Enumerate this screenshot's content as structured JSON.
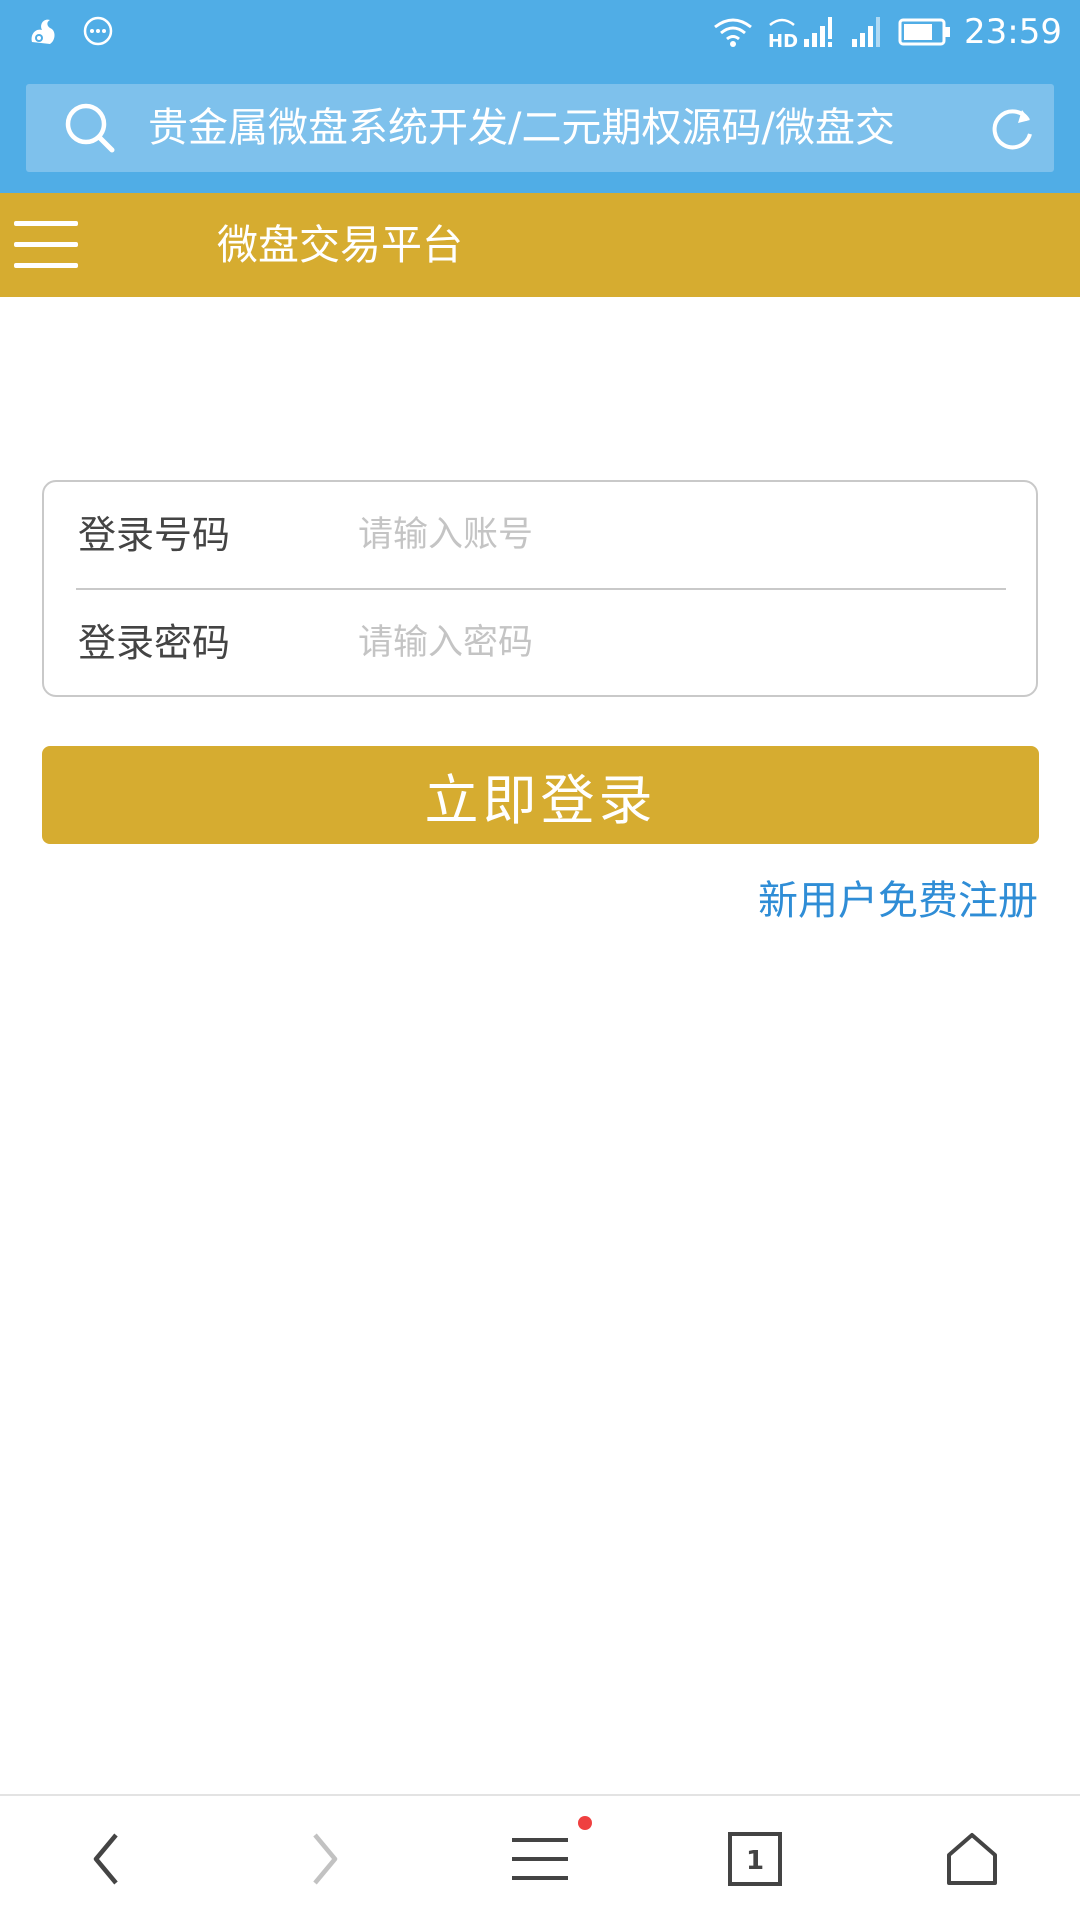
{
  "status_bar": {
    "time": "23:59",
    "network_label": "HD"
  },
  "browser": {
    "address_text": "贵金属微盘系统开发/二元期权源码/微盘交"
  },
  "header": {
    "title": "微盘交易平台"
  },
  "login_form": {
    "account_label": "登录号码",
    "account_placeholder": "请输入账号",
    "password_label": "登录密码",
    "password_placeholder": "请输入密码",
    "submit_label": "立即登录",
    "register_link": "新用户免费注册"
  },
  "bottom_bar": {
    "tab_count": "1"
  },
  "colors": {
    "status_blue": "#50ade6",
    "address_box": "#7ec1ec",
    "gold": "#d6ac30",
    "link_blue": "#2f8dd6",
    "notify_red": "#ef4040"
  },
  "icons": {
    "status_left": [
      "uc-squirrel-icon",
      "message-bubble-icon"
    ],
    "status_right": [
      "wifi-icon",
      "hd-signal-icon",
      "cell-signal-icon",
      "cell-signal-2-icon",
      "battery-icon"
    ],
    "address": [
      "search-icon",
      "refresh-icon"
    ],
    "header": [
      "hamburger-menu-icon"
    ],
    "bottom_bar": [
      "back-arrow-icon",
      "forward-arrow-icon",
      "menu-icon",
      "tabs-icon",
      "home-icon"
    ]
  }
}
